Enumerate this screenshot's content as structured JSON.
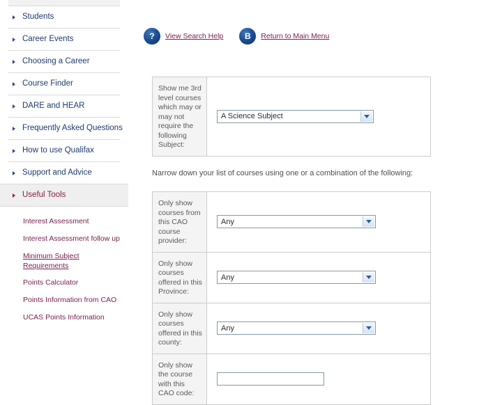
{
  "sidebar": {
    "items": [
      {
        "label": "Students",
        "active": false
      },
      {
        "label": "Career Events",
        "active": false
      },
      {
        "label": "Choosing a Career",
        "active": false
      },
      {
        "label": "Course Finder",
        "active": false
      },
      {
        "label": "DARE and HEAR",
        "active": false
      },
      {
        "label": "Frequently Asked Questions",
        "active": false
      },
      {
        "label": "How to use Qualifax",
        "active": false
      },
      {
        "label": "Support and Advice",
        "active": false
      },
      {
        "label": "Useful Tools",
        "active": true
      }
    ],
    "sub_items": [
      {
        "label": "Interest Assessment",
        "current": false
      },
      {
        "label": "Interest Assessment follow up",
        "current": false
      },
      {
        "label": "Minimum Subject Requirements",
        "current": true
      },
      {
        "label": "Points Calculator",
        "current": false
      },
      {
        "label": "Points Information from CAO",
        "current": false
      },
      {
        "label": "UCAS Points Information",
        "current": false
      }
    ]
  },
  "helpbar": {
    "help_icon_glyph": "?",
    "help_link": "View Search Help",
    "menu_icon_glyph": "B",
    "menu_link": "Return to Main Menu"
  },
  "subject_panel": {
    "label": "Show me 3rd level courses which may or may not require the following Subject:",
    "select_value": "A Science Subject"
  },
  "narrow_hint": "Narrow down your list of courses using one or a combination of the following:",
  "narrow_panel": {
    "rows": [
      {
        "label": "Only show courses from this CAO course provider:",
        "value": "Any",
        "type": "select"
      },
      {
        "label": "Only show courses offered in this Province:",
        "value": "Any",
        "type": "select"
      },
      {
        "label": "Only show courses offered in this county:",
        "value": "Any",
        "type": "select"
      },
      {
        "label": "Only show the course with this CAO code:",
        "value": "",
        "type": "text"
      }
    ]
  },
  "colors": {
    "nav_link": "#1f3a6e",
    "nav_active": "#8a1f3d",
    "sub_link": "#7a2050",
    "icon_blue": "#1d4f91",
    "panel_border": "#cccccc",
    "label_bg": "#f4f4f4"
  }
}
